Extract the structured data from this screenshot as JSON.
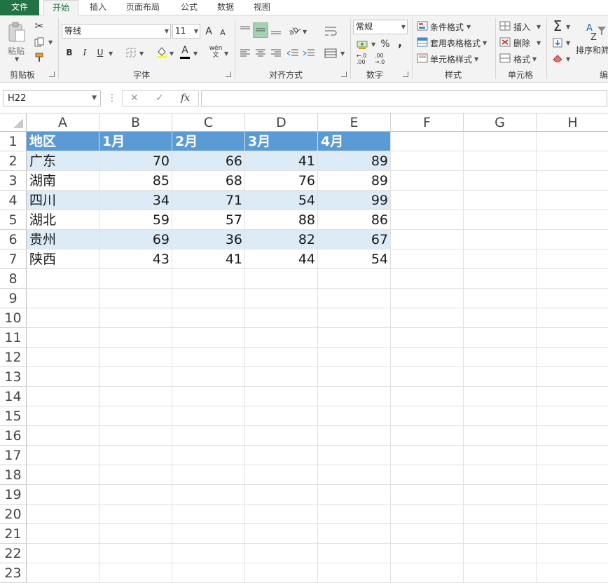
{
  "tabs": [
    "文件",
    "开始",
    "插入",
    "页面布局",
    "公式",
    "数据",
    "视图"
  ],
  "ribbon": {
    "clipboard": {
      "paste": "粘贴",
      "label": "剪贴板"
    },
    "font": {
      "name": "等线",
      "size": "11",
      "label": "字体",
      "bold": "B",
      "italic": "I",
      "underline": "U",
      "grow": "A",
      "shrink": "A",
      "color_a": "A",
      "phonetic": "wén"
    },
    "align": {
      "label": "对齐方式"
    },
    "number": {
      "format": "常规",
      "label": "数字",
      "percent": "%",
      "comma": ","
    },
    "styles": {
      "conditional": "条件格式",
      "table": "套用表格格式",
      "cell": "单元格样式",
      "label": "样式"
    },
    "cells": {
      "insert": "插入",
      "delete": "删除",
      "format": "格式",
      "label": "单元格"
    },
    "editing": {
      "sort": "排序和筛",
      "label": "编"
    }
  },
  "formula_bar": {
    "name_box": "H22",
    "cancel": "✕",
    "enter": "✓",
    "fx": "fx",
    "value": ""
  },
  "columns": [
    "A",
    "B",
    "C",
    "D",
    "E",
    "F",
    "G",
    "H"
  ],
  "rows": [
    "1",
    "2",
    "3",
    "4",
    "5",
    "6",
    "7",
    "8",
    "9",
    "10",
    "11",
    "12",
    "13",
    "14",
    "15",
    "16",
    "17",
    "18",
    "19",
    "20",
    "21",
    "22",
    "23"
  ],
  "colors": {
    "header_fill": "#5b9bd5",
    "band_fill": "#ddebf7",
    "file_tab": "#217346",
    "align_active": "#a3d3b4"
  },
  "table": {
    "headers": [
      "地区",
      "1月",
      "2月",
      "3月",
      "4月"
    ],
    "rows": [
      [
        "广东",
        "70",
        "66",
        "41",
        "89"
      ],
      [
        "湖南",
        "85",
        "68",
        "76",
        "89"
      ],
      [
        "四川",
        "34",
        "71",
        "54",
        "99"
      ],
      [
        "湖北",
        "59",
        "57",
        "88",
        "86"
      ],
      [
        "贵州",
        "69",
        "36",
        "82",
        "67"
      ],
      [
        "陕西",
        "43",
        "41",
        "44",
        "54"
      ]
    ]
  }
}
